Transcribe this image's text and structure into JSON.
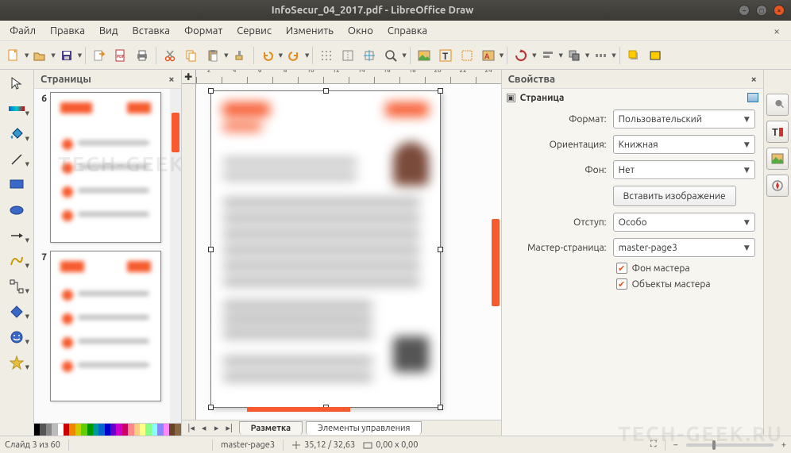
{
  "window": {
    "title": "InfoSecur_04_2017.pdf - LibreOffice Draw"
  },
  "menu": {
    "items": [
      "Файл",
      "Правка",
      "Вид",
      "Вставка",
      "Формат",
      "Сервис",
      "Изменить",
      "Окно",
      "Справка"
    ],
    "close": "×"
  },
  "toolbar": {
    "new": "new",
    "open": "open",
    "save": "save",
    "export": "export",
    "pdf": "pdf",
    "print": "print",
    "cut": "cut",
    "copy": "copy",
    "paste": "paste",
    "clone": "clone",
    "undo": "undo",
    "redo": "redo",
    "grid": "grid",
    "snap": "snap",
    "guides": "guides",
    "zoomselect": "zoomselect",
    "img": "image",
    "text": "text",
    "frame": "frame",
    "fontwork": "fontwork",
    "rotate": "rotate",
    "align": "align",
    "arrange": "arrange",
    "distribute": "distribute",
    "shadow": "shadow",
    "crop": "crop",
    "checkbox": "checkbox"
  },
  "left_tools": [
    "pointer",
    "fill-gradient",
    "fill-bucket",
    "line",
    "rectangle",
    "ellipse",
    "arrow",
    "curve",
    "connector",
    "diamond",
    "smiley",
    "star"
  ],
  "pages_panel": {
    "title": "Страницы",
    "thumbs": [
      {
        "num": "6"
      },
      {
        "num": "7"
      }
    ]
  },
  "ruler_marks": [
    "2",
    "4",
    "6",
    "8",
    "10",
    "12",
    "14",
    "16",
    "18",
    "20",
    "22",
    "24"
  ],
  "canvas_tabs": {
    "nav": [
      "|◂",
      "◂",
      "▸",
      "▸|"
    ],
    "tabs": [
      "Разметка",
      "Элементы управления"
    ],
    "active": 0
  },
  "properties": {
    "title": "Свойства",
    "section": "Страница",
    "rows": {
      "format": {
        "label": "Формат:",
        "value": "Пользовательский"
      },
      "orientation": {
        "label": "Ориентация:",
        "value": "Книжная"
      },
      "background": {
        "label": "Фон:",
        "value": "Нет"
      },
      "insert_image": "Вставить изображение",
      "margin": {
        "label": "Отступ:",
        "value": "Особо"
      },
      "master": {
        "label": "Мастер-страница:",
        "value": "master-page3"
      },
      "chk_master_bg": "Фон мастера",
      "chk_master_obj": "Объекты мастера"
    }
  },
  "right_tools": [
    "wrench",
    "text-style",
    "gallery",
    "navigator"
  ],
  "statusbar": {
    "slide": "Слайд 3 из 60",
    "master": "master-page3",
    "pos": "35,12 / 32,63",
    "size": "0,00 x 0,00",
    "zoom_out": "−",
    "zoom_in": "+",
    "fit": "⛶"
  },
  "color_palette": [
    "#000",
    "#555",
    "#888",
    "#bbb",
    "#fff",
    "#c00",
    "#e80",
    "#cc0",
    "#6c0",
    "#090",
    "#099",
    "#06c",
    "#00c",
    "#60c",
    "#c0c",
    "#c06",
    "#f88",
    "#fc8",
    "#ff8",
    "#8f8",
    "#8ff",
    "#88f",
    "#f8f",
    "#642",
    "#864"
  ],
  "watermark": "TECH-GEEK.RU"
}
